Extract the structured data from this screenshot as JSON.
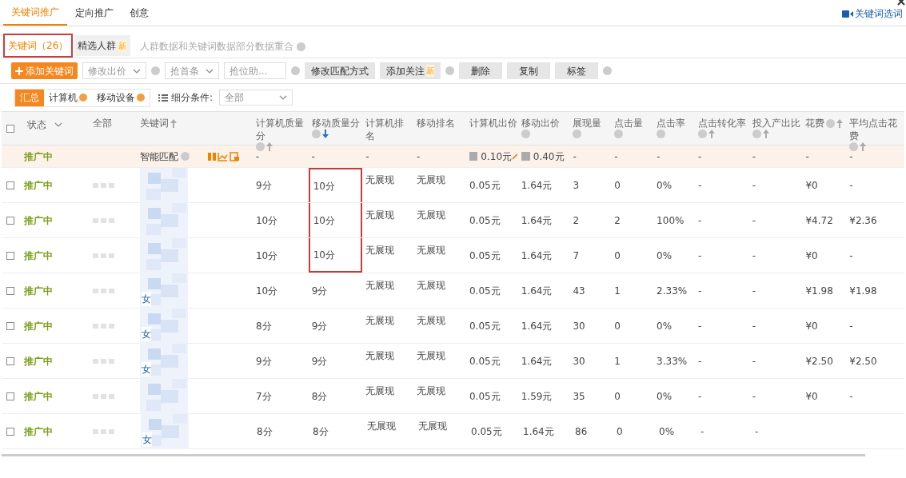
{
  "top_tabs": [
    {
      "label": "关键词推广",
      "selected": true
    },
    {
      "label": "定向推广",
      "selected": false
    },
    {
      "label": "创意",
      "selected": false
    }
  ],
  "top_link": "关键词选词",
  "sub_tabs": [
    {
      "label": "关键词（26）",
      "selected": true,
      "highlighted": true
    },
    {
      "label": "精选人群",
      "selected": false,
      "highlighted": false,
      "badge": "新"
    }
  ],
  "sub_note": "人群数据和关键词数据部分数据重合",
  "toolbar": [
    {
      "kind": "primary",
      "label": "添加关键词",
      "help": false
    },
    {
      "kind": "dropdown",
      "label": "修改出价",
      "help": true
    },
    {
      "kind": "dropdown",
      "label": "抢首条",
      "help": false
    },
    {
      "kind": "input",
      "label": "抢位助...",
      "help": true
    },
    {
      "kind": "button",
      "label": "修改匹配方式",
      "help": false
    },
    {
      "kind": "button",
      "label": "添加关注",
      "badge": "新",
      "help": true
    },
    {
      "kind": "button",
      "label": "删除",
      "help": false
    },
    {
      "kind": "button",
      "label": "复制",
      "help": false
    },
    {
      "kind": "button",
      "label": "标签",
      "help": true
    }
  ],
  "segments": [
    {
      "label": "汇总",
      "selected": true,
      "help": false
    },
    {
      "label": "计算机",
      "selected": false,
      "help": true
    },
    {
      "label": "移动设备",
      "selected": false,
      "help": true
    }
  ],
  "filter": {
    "label": "细分条件:",
    "value": "全部"
  },
  "header_checkbox": {
    "checked": false
  },
  "columns": [
    {
      "label": "状态",
      "kind": "dropdown"
    },
    {
      "label": "全部",
      "kind": "plain"
    },
    {
      "label": "关键词",
      "kind": "sort",
      "help": false,
      "sorted": false
    },
    {
      "label": "计算机质量分",
      "kind": "sort",
      "help": true,
      "sorted": false
    },
    {
      "label": "移动质量分",
      "kind": "sort",
      "help": true,
      "sorted": true
    },
    {
      "label": "计算机排名",
      "kind": "plain"
    },
    {
      "label": "移动排名",
      "kind": "plain"
    },
    {
      "label": "计算机出价",
      "kind": "plain"
    },
    {
      "label": "移动出价",
      "kind": "sort",
      "help": true
    },
    {
      "label": "展现量",
      "kind": "sort",
      "help": true
    },
    {
      "label": "点击量",
      "kind": "sort",
      "help": true
    },
    {
      "label": "点击率",
      "kind": "sort",
      "help": true
    },
    {
      "label": "点击转化率",
      "kind": "sort",
      "help": true,
      "sorted": false
    },
    {
      "label": "投入产出比",
      "kind": "sort",
      "help": true,
      "sorted": false
    },
    {
      "label": "花费",
      "kind": "sort",
      "help": true,
      "sorted": false
    },
    {
      "label": "平均点击花费",
      "kind": "sort",
      "help": true,
      "sorted": false
    }
  ],
  "smart_row": {
    "status": "推广中",
    "label": "智能匹配",
    "cells": [
      "-",
      "-",
      "-",
      "-",
      "0.10元",
      "0.40元",
      "-",
      "-",
      "-",
      "-",
      "-",
      "-",
      "-"
    ]
  },
  "rows": [
    {
      "status": "推广中",
      "checked": false,
      "highlight": true,
      "cells": [
        "9分",
        "10分",
        "无展现",
        "无展现",
        "0.05元",
        "1.64元",
        "3",
        "0",
        "0%",
        "-",
        "-",
        "¥0",
        "-"
      ]
    },
    {
      "status": "推广中",
      "checked": false,
      "highlight": true,
      "cells": [
        "10分",
        "10分",
        "无展现",
        "无展现",
        "0.05元",
        "1.64元",
        "2",
        "2",
        "100%",
        "-",
        "-",
        "¥4.72",
        "¥2.36"
      ]
    },
    {
      "status": "推广中",
      "checked": false,
      "highlight": true,
      "cells": [
        "10分",
        "10分",
        "无展现",
        "无展现",
        "0.05元",
        "1.64元",
        "7",
        "0",
        "0%",
        "-",
        "-",
        "¥0",
        "-"
      ]
    },
    {
      "status": "推广中",
      "checked": false,
      "highlight": false,
      "keyword_fragment": "女",
      "cells": [
        "10分",
        "9分",
        "无展现",
        "无展现",
        "0.05元",
        "1.64元",
        "43",
        "1",
        "2.33%",
        "-",
        "-",
        "¥1.98",
        "¥1.98"
      ]
    },
    {
      "status": "推广中",
      "checked": false,
      "highlight": false,
      "keyword_fragment": "女",
      "cells": [
        "8分",
        "9分",
        "无展现",
        "无展现",
        "0.05元",
        "1.64元",
        "30",
        "0",
        "0%",
        "-",
        "-",
        "¥0",
        "-"
      ]
    },
    {
      "status": "推广中",
      "checked": false,
      "highlight": false,
      "keyword_fragment": "女",
      "cells": [
        "9分",
        "9分",
        "无展现",
        "无展现",
        "0.05元",
        "1.64元",
        "30",
        "1",
        "3.33%",
        "-",
        "-",
        "¥2.50",
        "¥2.50"
      ]
    },
    {
      "status": "推广中",
      "checked": false,
      "highlight": false,
      "cells": [
        "7分",
        "8分",
        "无展现",
        "无展现",
        "0.05元",
        "1.59元",
        "35",
        "0",
        "0%",
        "-",
        "-",
        "¥0",
        "-"
      ]
    },
    {
      "status": "推广中",
      "checked": false,
      "highlight": false,
      "keyword_fragment": "女",
      "cells": [
        "8分",
        "8分",
        "无展现",
        "无展现",
        "0.05元",
        "1.64元",
        "86",
        "0",
        "0%",
        "-",
        "-"
      ]
    }
  ]
}
